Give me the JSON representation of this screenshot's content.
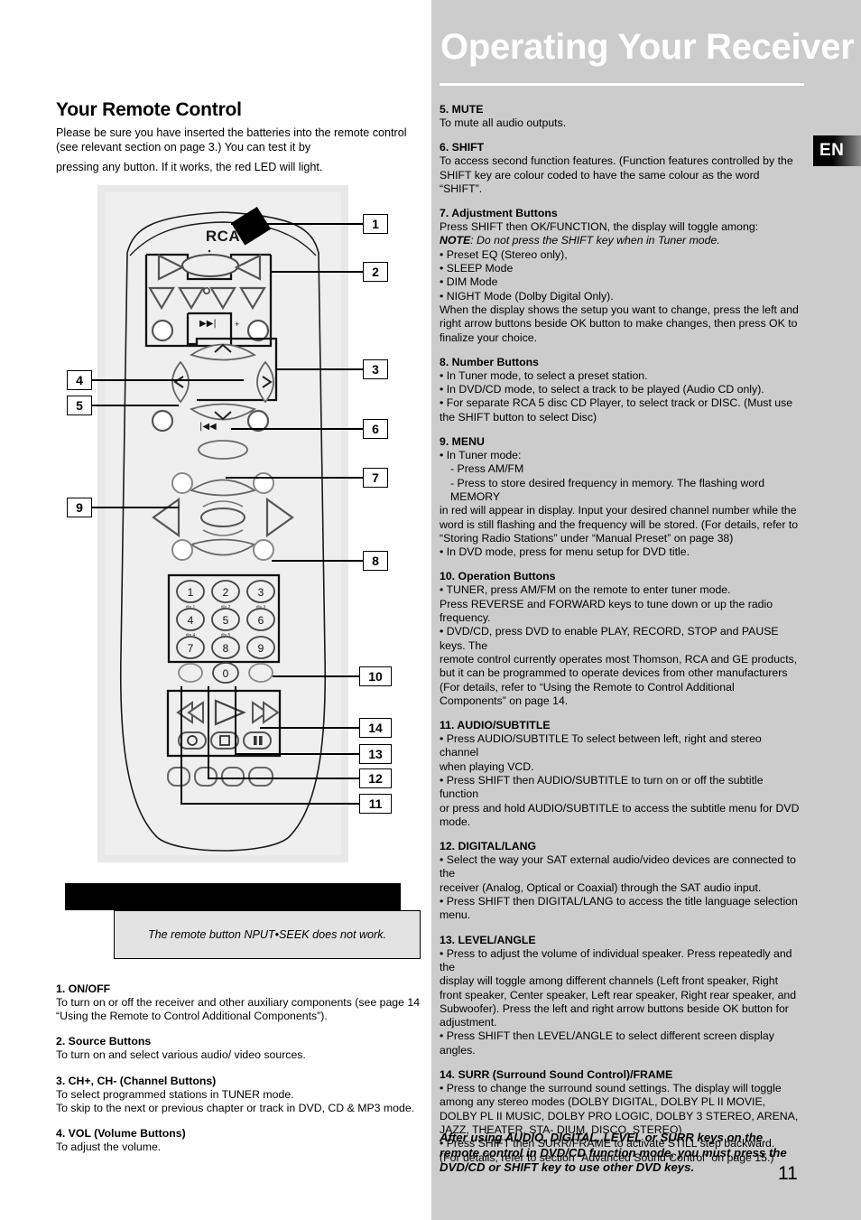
{
  "header": {
    "title": "Operating Your Receiver",
    "lang_badge": "EN"
  },
  "left": {
    "heading": "Your Remote Control",
    "intro_line1": "Please be sure you have inserted the batteries into the remote",
    "intro_line2": "control (see relevant section on page 3.) You can test it by",
    "intro_line3": "pressing any button. If it works, the red LED will light.",
    "brand_logo": "RCA",
    "note_text": "The remote button NPUT•SEEK does  not work.",
    "callouts": [
      {
        "id": "1",
        "label": "1"
      },
      {
        "id": "2",
        "label": "2"
      },
      {
        "id": "3",
        "label": "3"
      },
      {
        "id": "4",
        "label": "4"
      },
      {
        "id": "5",
        "label": "5"
      },
      {
        "id": "6",
        "label": "6"
      },
      {
        "id": "7",
        "label": "7"
      },
      {
        "id": "8",
        "label": "8"
      },
      {
        "id": "9",
        "label": "9"
      },
      {
        "id": "10",
        "label": "10"
      },
      {
        "id": "11",
        "label": "11"
      },
      {
        "id": "12",
        "label": "12"
      },
      {
        "id": "13",
        "label": "13"
      },
      {
        "id": "14",
        "label": "14"
      }
    ],
    "keypad_digits": [
      "1",
      "2",
      "3",
      "4",
      "5",
      "6",
      "7",
      "8",
      "9",
      "0"
    ],
    "keypad_sublabels": [
      "dis  1",
      "dis  2",
      "dis  3",
      "dis  4",
      "dis  5"
    ],
    "sections": [
      {
        "heading": "1. ON/OFF",
        "body_l1": "To turn on or off the receiver and other auxiliary components (see page 14",
        "body_l2": "“Using the Remote to Control Additional Components”)."
      },
      {
        "heading": "2. Source Buttons",
        "body_l1": "To turn on and select various audio/ video sources.",
        "body_l2": ""
      },
      {
        "heading": "3. CH+, CH- (Channel Buttons)",
        "body_l1": "To select programmed stations  in TUNER mode.",
        "body_l2": "To skip to the next or previous chapter or track in DVD, CD & MP3 mode."
      },
      {
        "heading": "4. VOL (Volume Buttons)",
        "body_l1": "To adjust the volume.",
        "body_l2": ""
      }
    ]
  },
  "right": {
    "sections": [
      {
        "heading": "5. MUTE",
        "lines": [
          "To mute all audio outputs."
        ]
      },
      {
        "heading": "6. SHIFT",
        "lines": [
          "To access second function features. (Function features controlled by the",
          "SHIFT key are  colour coded to have the same colour as the word “SHIFT”."
        ]
      },
      {
        "heading": "7. Adjustment Buttons",
        "lines": [
          "Press SHIFT then OK/FUNCTION, the display will toggle among:",
          "NOTE: Do not press the SHIFT key when in Tuner mode.",
          "• Preset EQ (Stereo only),",
          "• SLEEP Mode",
          "• DIM Mode",
          "• NIGHT Mode (Dolby Digital Only).",
          "When the display shows the setup you want to change, press the left and",
          "right arrow buttons beside OK button to make changes, then press OK to",
          "finalize your choice."
        ],
        "note_bold": "NOTE",
        "note_rest": ": Do not press the SHIFT key when in Tuner mode."
      },
      {
        "heading": "8.  Number Buttons",
        "lines": [
          "• In Tuner mode, to select a preset station.",
          "• In DVD/CD mode, to select a track to be played (Audio CD only).",
          "• For separate RCA 5 disc CD Player, to select track or DISC. (Must use the",
          "SHIFT button to select Disc)"
        ]
      },
      {
        "heading": "9.  MENU",
        "lines": [
          "• In Tuner mode:",
          "- Press AM/FM",
          "- Press to store desired frequency in memory. The flashing word MEMORY",
          "in red will appear in display. Input your desired channel number while the",
          "word is still flashing and the frequency will be stored. (For details, refer to",
          "“Storing Radio Stations” under “Manual Preset” on page 38)",
          "• In DVD mode, press for menu setup for DVD title."
        ]
      },
      {
        "heading": "10. Operation Buttons",
        "lines": [
          "• TUNER, press AM/FM on the remote to enter tuner mode.",
          "Press REVERSE and FORWARD keys to tune down or up the radio frequency.",
          "• DVD/CD, press DVD to enable PLAY, RECORD, STOP and PAUSE keys. The",
          "remote control currently operates most Thomson, RCA and GE products,",
          "but it can be programmed to operate devices from other manufacturers",
          "(For details, refer to “Using the Remote to Control Additional Components”",
          "on page  14."
        ]
      },
      {
        "heading": "11. AUDIO/SUBTITLE",
        "lines": [
          "• Press AUDIO/SUBTITLE To select between left, right and stereo channel",
          "when playing VCD.",
          "• Press SHIFT then AUDIO/SUBTITLE to turn on or off the subtitle function",
          "or press and hold AUDIO/SUBTITLE to access the subtitle menu for DVD",
          "mode."
        ]
      },
      {
        "heading": "12. DIGITAL/LANG",
        "lines": [
          "• Select the way your SAT external audio/video devices are connected to the",
          "receiver (Analog, Optical or Coaxial) through the SAT audio input.",
          "• Press SHIFT then DIGITAL/LANG to access the title language selection",
          "menu."
        ]
      },
      {
        "heading": "13. LEVEL/ANGLE",
        "lines": [
          "• Press to adjust the volume of individual speaker. Press repeatedly and the",
          "display will toggle among different channels (Left front speaker, Right front",
          "speaker, Center speaker, Left rear speaker, Right rear speaker, and",
          "Subwoofer). Press the left and right arrow buttons beside OK button for",
          "adjustment.",
          "• Press SHIFT then LEVEL/ANGLE to select different screen display angles."
        ]
      },
      {
        "heading": "14.  SURR (Surround Sound Control)/FRAME",
        "lines": [
          "• Press to change the surround sound settings. The display will toggle",
          "among any stereo modes (DOLBY DIGITAL, DOLBY PL II MOVIE, DOLBY PL II",
          "MUSIC, DOLBY PRO LOGIC, DOLBY 3 STEREO, ARENA, JAZZ, THEATER, STA-",
          "DIUM, DISCO, STEREO)",
          "• Press SHIFT then SURR/FRAME to activate STILL step backward.",
          "(For details, refer to section “Advanced Sound Control” on page 15.)"
        ]
      }
    ],
    "closing_l1": "After using AUDIO, DIGITAL, LEVEL or SURR keys on the",
    "closing_l2": "remote control in DVD/CD function mode, you must press",
    "closing_l3": "the DVD/CD or SHIFT key to use other DVD keys.",
    "page_number": "11"
  },
  "colors": {
    "panel_gray": "#cccccc",
    "remote_bg": "#efefef",
    "title_white": "#ffffff",
    "note_black": "#000000"
  }
}
